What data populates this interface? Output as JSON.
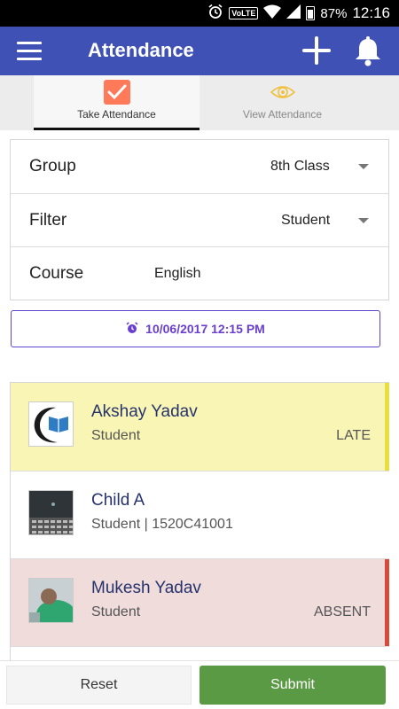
{
  "status_bar": {
    "icons": [
      "alarm-icon",
      "volte-icon",
      "wifi-icon",
      "signal-icon",
      "battery-icon"
    ],
    "volte_label": "VoLTE",
    "battery": "87%",
    "time": "12:16"
  },
  "app_bar": {
    "title": "Attendance",
    "icons": [
      "menu-icon",
      "add-icon",
      "bell-icon"
    ],
    "color": "#3f51b5"
  },
  "tabs": [
    {
      "label": "Take Attendance",
      "icon": "checkbox-icon",
      "active": true
    },
    {
      "label": "View Attendance",
      "icon": "eye-icon",
      "active": false
    }
  ],
  "form": {
    "group": {
      "label": "Group",
      "value": "8th Class"
    },
    "filter": {
      "label": "Filter",
      "value": "Student"
    },
    "course": {
      "label": "Course",
      "value": "English"
    }
  },
  "date_button": {
    "label": "10/06/2017 12:15 PM",
    "icon": "alarm-clock-icon",
    "color": "#6a3fcf"
  },
  "students": [
    {
      "name": "Akshay Yadav",
      "subtitle": "Student",
      "status": "LATE",
      "bg": "#f8f5b5",
      "stripe": "#e8df3d"
    },
    {
      "name": "Child A",
      "subtitle": "Student | 1520C41001",
      "status": "",
      "bg": "#ffffff",
      "stripe": ""
    },
    {
      "name": "Mukesh Yadav",
      "subtitle": "Student",
      "status": "ABSENT",
      "bg": "#f1dcdc",
      "stripe": "#d84a3a"
    }
  ],
  "buttons": {
    "reset": "Reset",
    "submit": "Submit",
    "submit_color": "#5b9a45"
  }
}
